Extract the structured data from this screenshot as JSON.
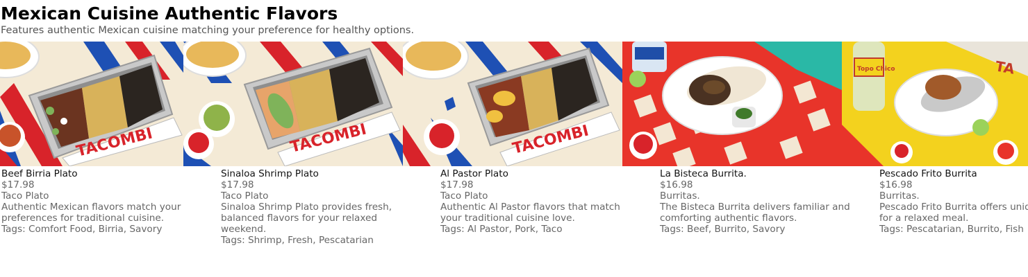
{
  "section": {
    "title": "Mexican Cuisine Authentic Flavors",
    "subtitle": "Features authentic Mexican cuisine matching your preference for healthy options."
  },
  "items": [
    {
      "name": "Beef Birria Plato",
      "price": "$17.98",
      "category": "Taco Plato",
      "description": "Authentic Mexican flavors match your preferences for traditional cuisine.",
      "tags": "Tags: Comfort Food, Birria, Savory",
      "image_brand": "TACOMBI"
    },
    {
      "name": "Sinaloa Shrimp Plato",
      "price": "$17.98",
      "category": "Taco Plato",
      "description": "Sinaloa Shrimp Plato provides fresh, balanced flavors for your relaxed weekend.",
      "tags": "Tags: Shrimp, Fresh, Pescatarian",
      "image_brand": "TACOMBI"
    },
    {
      "name": "Al Pastor Plato",
      "price": "$17.98",
      "category": "Taco Plato",
      "description": "Authentic Al Pastor flavors that match your traditional cuisine love.",
      "tags": "Tags: Al Pastor, Pork, Taco",
      "image_brand": "TACOMBI"
    },
    {
      "name": "La Bisteca Burrita.",
      "price": "$16.98",
      "category": "Burritas.",
      "description": "The Bisteca Burrita delivers familiar and comforting authentic flavors.",
      "tags": "Tags: Beef, Burrito, Savory"
    },
    {
      "name": "Pescado Frito Burrita",
      "price": "$16.98",
      "category": "Burritas.",
      "description": "Pescado Frito Burrita offers unique flavors for a relaxed meal.",
      "tags": "Tags: Pescatarian, Burrito, Fish",
      "image_brand": "Topo Chico"
    }
  ]
}
